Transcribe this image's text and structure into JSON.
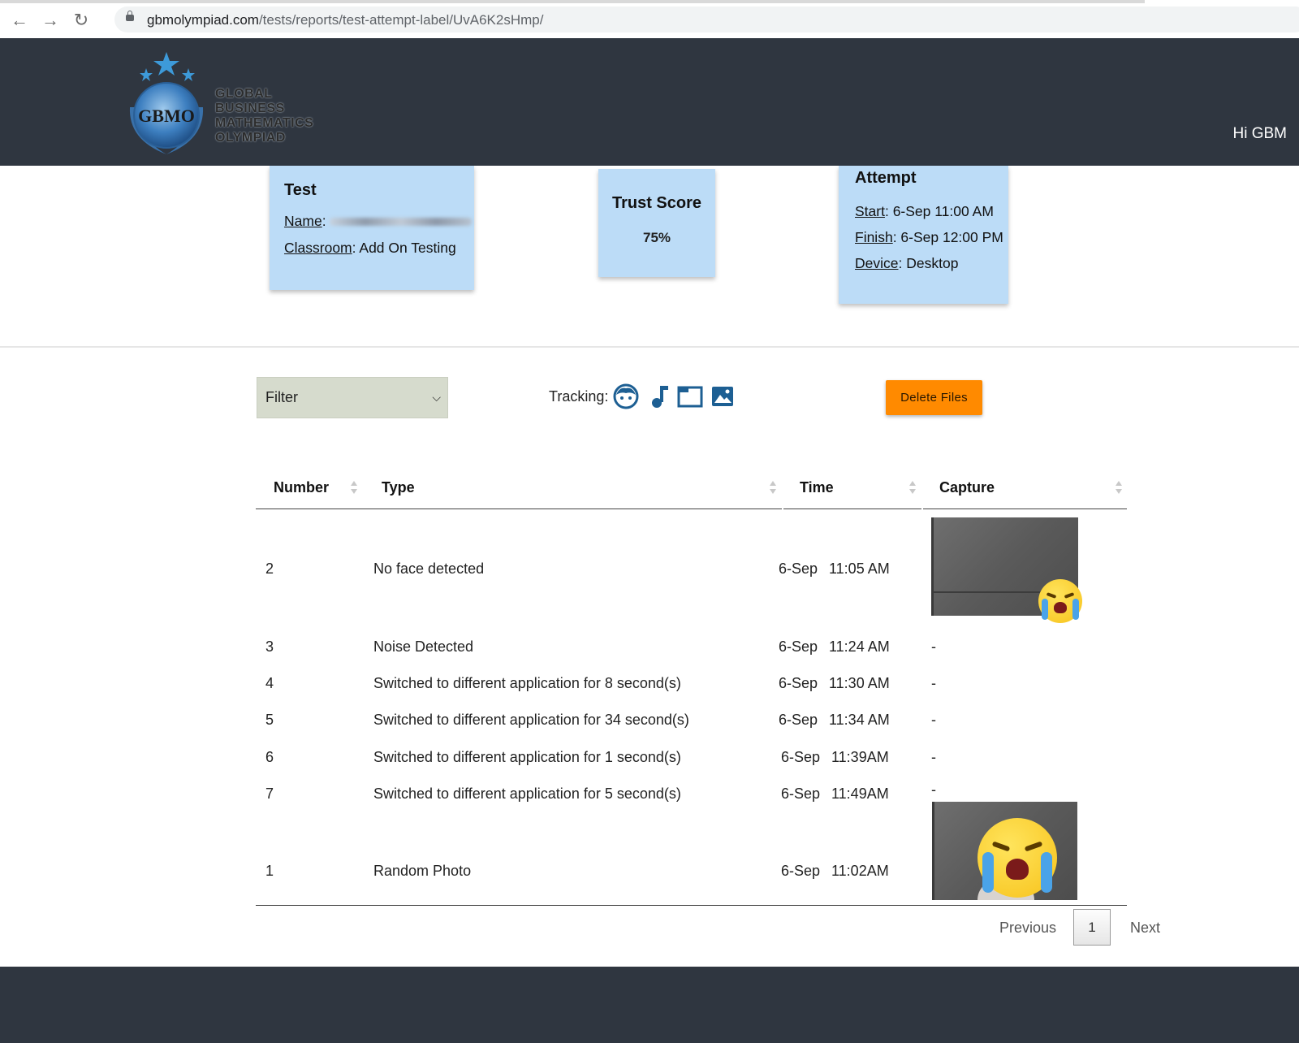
{
  "browser": {
    "url_host": "gbmolympiad.com",
    "url_path": "/tests/reports/test-attempt-label/UvA6K2sHmp/"
  },
  "header": {
    "logo_text": [
      "GLOBAL",
      "BUSINESS",
      "MATHEMATICS",
      "OLYMPIAD"
    ],
    "logo_monogram": "GBMO",
    "greeting": "Hi GBM"
  },
  "test_card": {
    "title": "Test",
    "name_label": "Name",
    "classroom_label": "Classroom",
    "classroom_value": ": Add On Testing"
  },
  "trust_card": {
    "title": "Trust Score",
    "value": "75%"
  },
  "attempt_card": {
    "title": "Attempt",
    "start_label": "Start",
    "start_value": ":  6-Sep 11:00 AM",
    "finish_label": "Finish",
    "finish_value": ": 6-Sep 12:00 PM",
    "device_label": "Device",
    "device_value": ": Desktop"
  },
  "controls": {
    "filter_value": "Filter",
    "tracking_label": "Tracking:",
    "tracking_icons": [
      "face-icon",
      "music-note-icon",
      "window-icon",
      "image-icon"
    ],
    "delete_label": "Delete Files"
  },
  "table": {
    "headers": [
      "Number",
      "Type",
      "Time",
      "Capture"
    ],
    "rows": [
      {
        "number": "2",
        "type": "No face detected",
        "date": "6-Sep",
        "time": "11:05 AM",
        "capture": "photo"
      },
      {
        "number": "3",
        "type": "Noise Detected",
        "date": "6-Sep",
        "time": "11:24 AM",
        "capture": "-"
      },
      {
        "number": "4",
        "type": "Switched to different application for 8 second(s)",
        "date": "6-Sep",
        "time": "11:30 AM",
        "capture": "-"
      },
      {
        "number": "5",
        "type": "Switched to different application for 34 second(s)",
        "date": "6-Sep",
        "time": "11:34 AM",
        "capture": "-"
      },
      {
        "number": "6",
        "type": "Switched to different application for 1 second(s)",
        "date": "6-Sep",
        "time": "11:39AM",
        "capture": "-"
      },
      {
        "number": "7",
        "type": "Switched to different application for 5 second(s)",
        "date": "6-Sep",
        "time": "11:49AM",
        "capture": "-"
      },
      {
        "number": "1",
        "type": "Random Photo",
        "date": "6-Sep",
        "time": "11:02AM",
        "capture": "photo"
      }
    ]
  },
  "pagination": {
    "previous": "Previous",
    "page": "1",
    "next": "Next"
  },
  "colors": {
    "header_bg": "#2f3640",
    "card_bg": "#bcdcf7",
    "filter_bg": "#d6dbcd",
    "delete_btn": "#ff8a00",
    "icon_blue": "#1d5f93"
  }
}
